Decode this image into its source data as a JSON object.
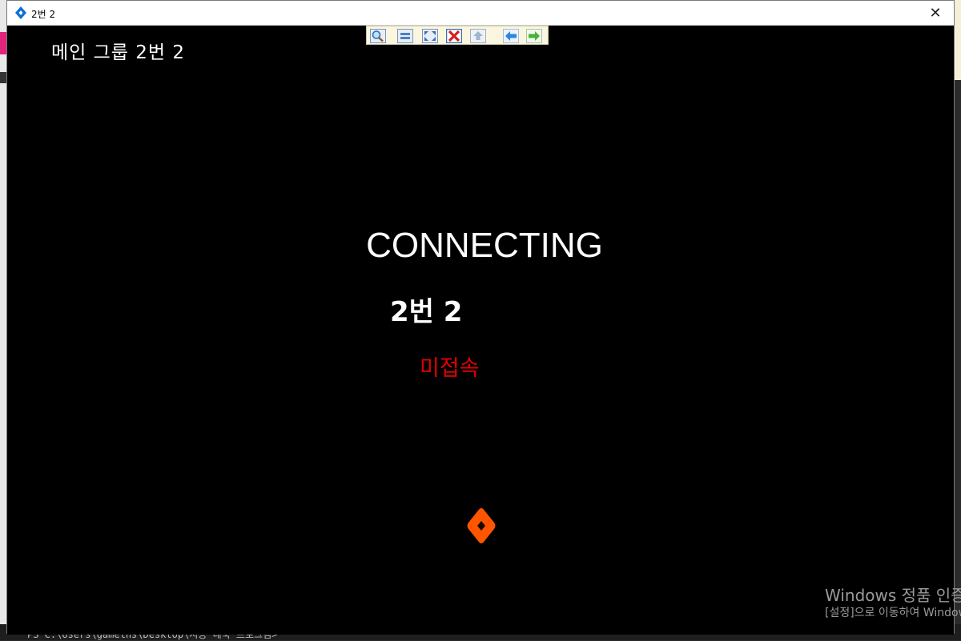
{
  "window": {
    "title": "2번 2",
    "app_icon": "diamond-logo-icon",
    "close_icon": "close-icon",
    "close_label": "✕"
  },
  "main": {
    "group_label": "메인 그룹 2번 2",
    "connecting_text": "CONNECTING",
    "device_name": "2번 2",
    "status_text": "미접속",
    "status_color": "#e00000",
    "loader_icon": "orange-diamond-loader-icon",
    "loader_color": "#ff5500"
  },
  "toolbar": {
    "buttons": [
      {
        "name": "zoom-icon",
        "color": "#2d6fb8"
      },
      {
        "name": "fit-window-icon",
        "color": "#4c7fc0"
      },
      {
        "name": "fullscreen-icon",
        "color": "#3a6eb5"
      },
      {
        "name": "close-session-icon",
        "color": "#d42020"
      },
      {
        "name": "upload-icon",
        "color": "#8fa8c8"
      },
      {
        "name": "back-arrow-icon",
        "color": "#2a86e0"
      },
      {
        "name": "forward-arrow-icon",
        "color": "#4caf3a"
      }
    ]
  },
  "desktop": {
    "terminal_text": "PS C:\\Users\\gamelns\\Desktop\\시공 내국 프로그램>",
    "watermark_title": "Windows 정품 인증",
    "watermark_sub": "[설정]으로 이동하여 Windows"
  }
}
